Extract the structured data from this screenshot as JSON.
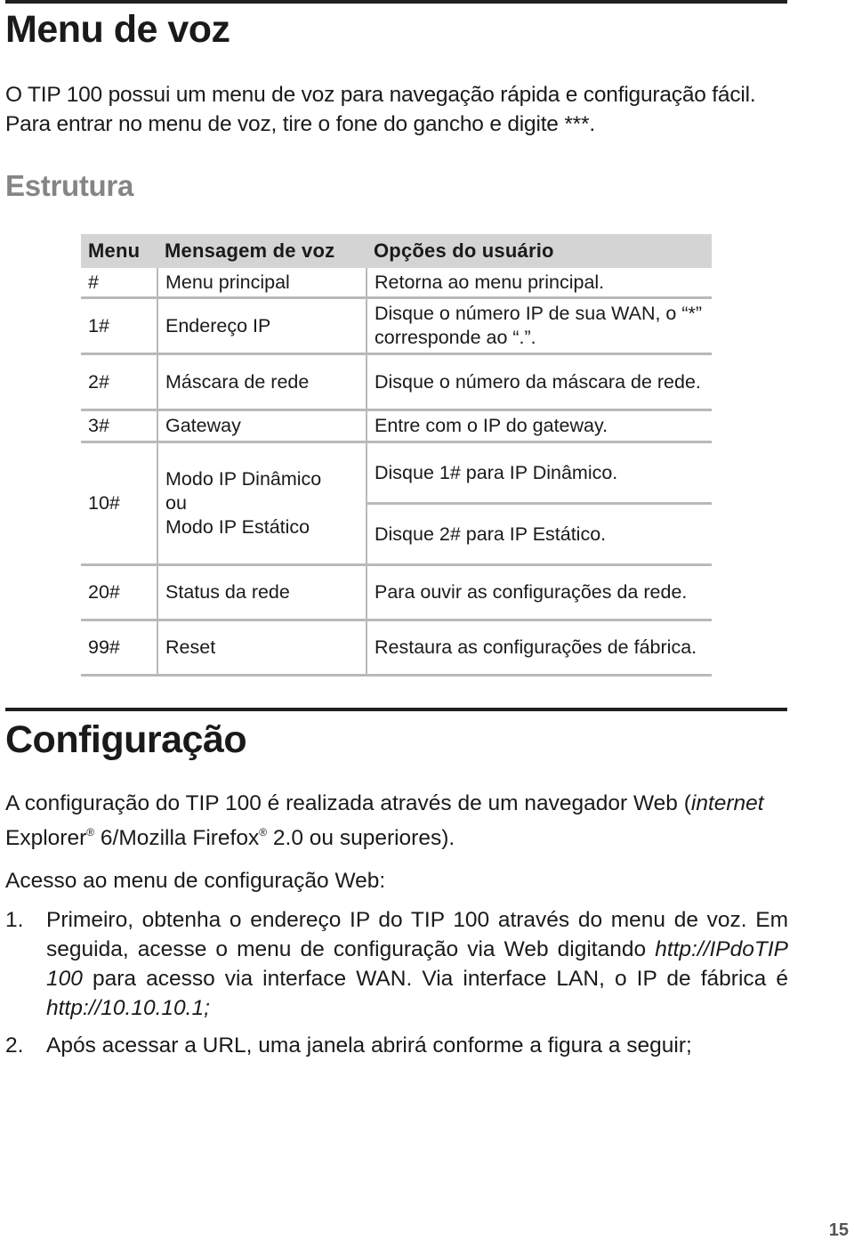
{
  "section_menu": {
    "title": "Menu de voz",
    "intro": "O TIP 100 possui um menu de voz para navegação rápida e configuração fácil. Para entrar no menu de voz, tire o fone do gancho e digite ***.",
    "subtitle": "Estrutura"
  },
  "table": {
    "headers": [
      "Menu",
      "Mensagem de voz",
      "Opções do usuário"
    ],
    "rows": [
      {
        "menu": "#",
        "message": "Menu principal",
        "options": [
          "Retorna ao menu principal."
        ]
      },
      {
        "menu": "1#",
        "message": "Endereço IP",
        "options": [
          "Disque o número IP de sua WAN, o “*” corresponde ao “.”."
        ]
      },
      {
        "menu": "2#",
        "message": "Máscara de rede",
        "options": [
          "Disque o número da máscara de rede."
        ]
      },
      {
        "menu": "3#",
        "message": "Gateway",
        "options": [
          "Entre com o IP do gateway."
        ]
      },
      {
        "menu": "10#",
        "message_lines": [
          "Modo IP Dinâmico",
          "ou",
          "Modo IP Estático"
        ],
        "options": [
          "Disque 1# para IP Dinâmico.",
          "Disque 2# para IP Estático."
        ]
      },
      {
        "menu": "20#",
        "message": "Status da rede",
        "options": [
          "Para ouvir as configurações da rede."
        ]
      },
      {
        "menu": "99#",
        "message": "Reset",
        "options": [
          "Restaura as configurações de fábrica."
        ]
      }
    ]
  },
  "section_config": {
    "title": "Configuração",
    "para_a": "A configuração do TIP 100 é realizada através de um navegador Web (",
    "para_italic": "internet",
    "para_b": " Explorer",
    "reg": "®",
    "para_c": " 6/Mozilla Firefox",
    "para_d": " 2.0 ou superiores).",
    "access_label": "Acesso ao menu de configuração Web:",
    "steps": [
      {
        "num": "1.",
        "text_a": "Primeiro, obtenha o endereço IP do TIP 100 através do menu de voz. Em seguida, acesse o menu de configuração via Web digitando ",
        "url_wan": "http://IPdoTIP 100",
        "text_b": " para acesso via interface WAN. Via interface LAN, o IP de fábrica é ",
        "url_lan": "http://10.10.10.1;"
      },
      {
        "num": "2.",
        "text": "Após acessar a URL, uma janela abrirá conforme a figura a seguir;"
      }
    ]
  },
  "page_number": "15"
}
